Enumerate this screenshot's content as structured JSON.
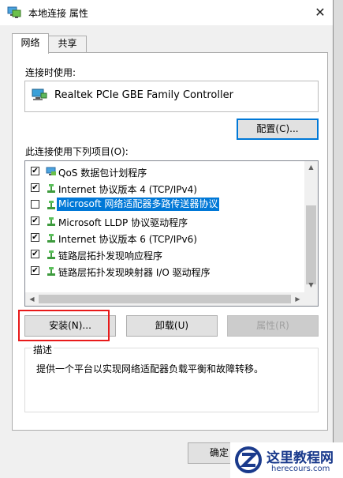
{
  "window": {
    "title": "本地连接 属性",
    "close": "✕"
  },
  "tabs": [
    {
      "label": "网络"
    },
    {
      "label": "共享"
    }
  ],
  "connect_using_label": "连接时使用:",
  "adapter": {
    "name": "Realtek PCIe GBE Family Controller",
    "icon": "network-adapter-icon"
  },
  "configure_button": "配置(C)...",
  "items_label": "此连接使用下列项目(O):",
  "items": [
    {
      "label": "QoS 数据包计划程序",
      "checked": true,
      "icon": "qos-icon"
    },
    {
      "label": "Internet 协议版本 4 (TCP/IPv4)",
      "checked": true,
      "icon": "protocol-icon"
    },
    {
      "label": "Microsoft 网络适配器多路传送器协议",
      "checked": false,
      "selected": true,
      "icon": "protocol-icon"
    },
    {
      "label": "Microsoft LLDP 协议驱动程序",
      "checked": true,
      "icon": "protocol-icon"
    },
    {
      "label": "Internet 协议版本 6 (TCP/IPv6)",
      "checked": true,
      "icon": "protocol-icon"
    },
    {
      "label": "链路层拓扑发现响应程序",
      "checked": true,
      "icon": "protocol-icon"
    },
    {
      "label": "链路层拓扑发现映射器 I/O 驱动程序",
      "checked": true,
      "icon": "protocol-icon"
    }
  ],
  "buttons": {
    "install": "安装(N)...",
    "uninstall": "卸载(U)",
    "properties": "属性(R)"
  },
  "description": {
    "legend": "描述",
    "text": "提供一个平台以实现网络适配器负载平衡和故障转移。"
  },
  "footer": {
    "ok": "确定"
  },
  "watermark": {
    "title": "这里教程网",
    "url": "herecours.com"
  },
  "colors": {
    "selection": "#0078d7",
    "highlight_box": "#e81a1a"
  }
}
